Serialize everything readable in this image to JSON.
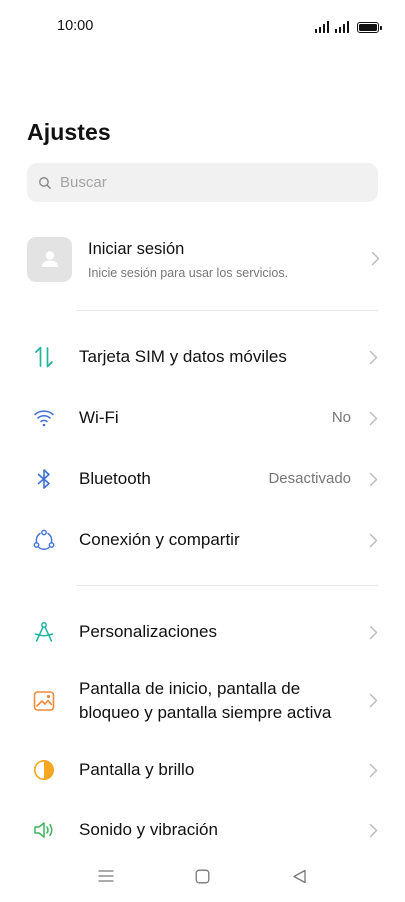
{
  "status_bar": {
    "time": "10:00"
  },
  "page": {
    "title": "Ajustes"
  },
  "search": {
    "placeholder": "Buscar"
  },
  "account": {
    "title": "Iniciar sesión",
    "subtitle": "Inicie sesión para usar los servicios."
  },
  "settings": {
    "sim": {
      "label": "Tarjeta SIM y datos móviles"
    },
    "wifi": {
      "label": "Wi-Fi",
      "value": "No"
    },
    "bluetooth": {
      "label": "Bluetooth",
      "value": "Desactivado"
    },
    "connection": {
      "label": "Conexión y compartir"
    },
    "personalization": {
      "label": "Personalizaciones"
    },
    "homescreen": {
      "label_line1": "Pantalla de inicio, pantalla de",
      "label_line2": "bloqueo y pantalla siempre activa"
    },
    "display": {
      "label": "Pantalla y brillo"
    },
    "sound": {
      "label": "Sonido y vibración"
    }
  },
  "icons": {
    "sim": "sim-data-arrows-icon",
    "wifi": "wifi-icon",
    "bluetooth": "bluetooth-icon",
    "connection": "connection-sharing-icon",
    "personalization": "compass-icon",
    "homescreen": "wallpaper-icon",
    "display": "brightness-icon",
    "sound": "speaker-icon"
  },
  "colors": {
    "sim": "#1fb5a0",
    "wifi": "#3f6fd8",
    "bluetooth": "#3f6fd8",
    "connection": "#3f6fd8",
    "personalization": "#1fb5a0",
    "homescreen": "#f08a3c",
    "display": "#f5a623",
    "sound": "#3fb35a"
  }
}
